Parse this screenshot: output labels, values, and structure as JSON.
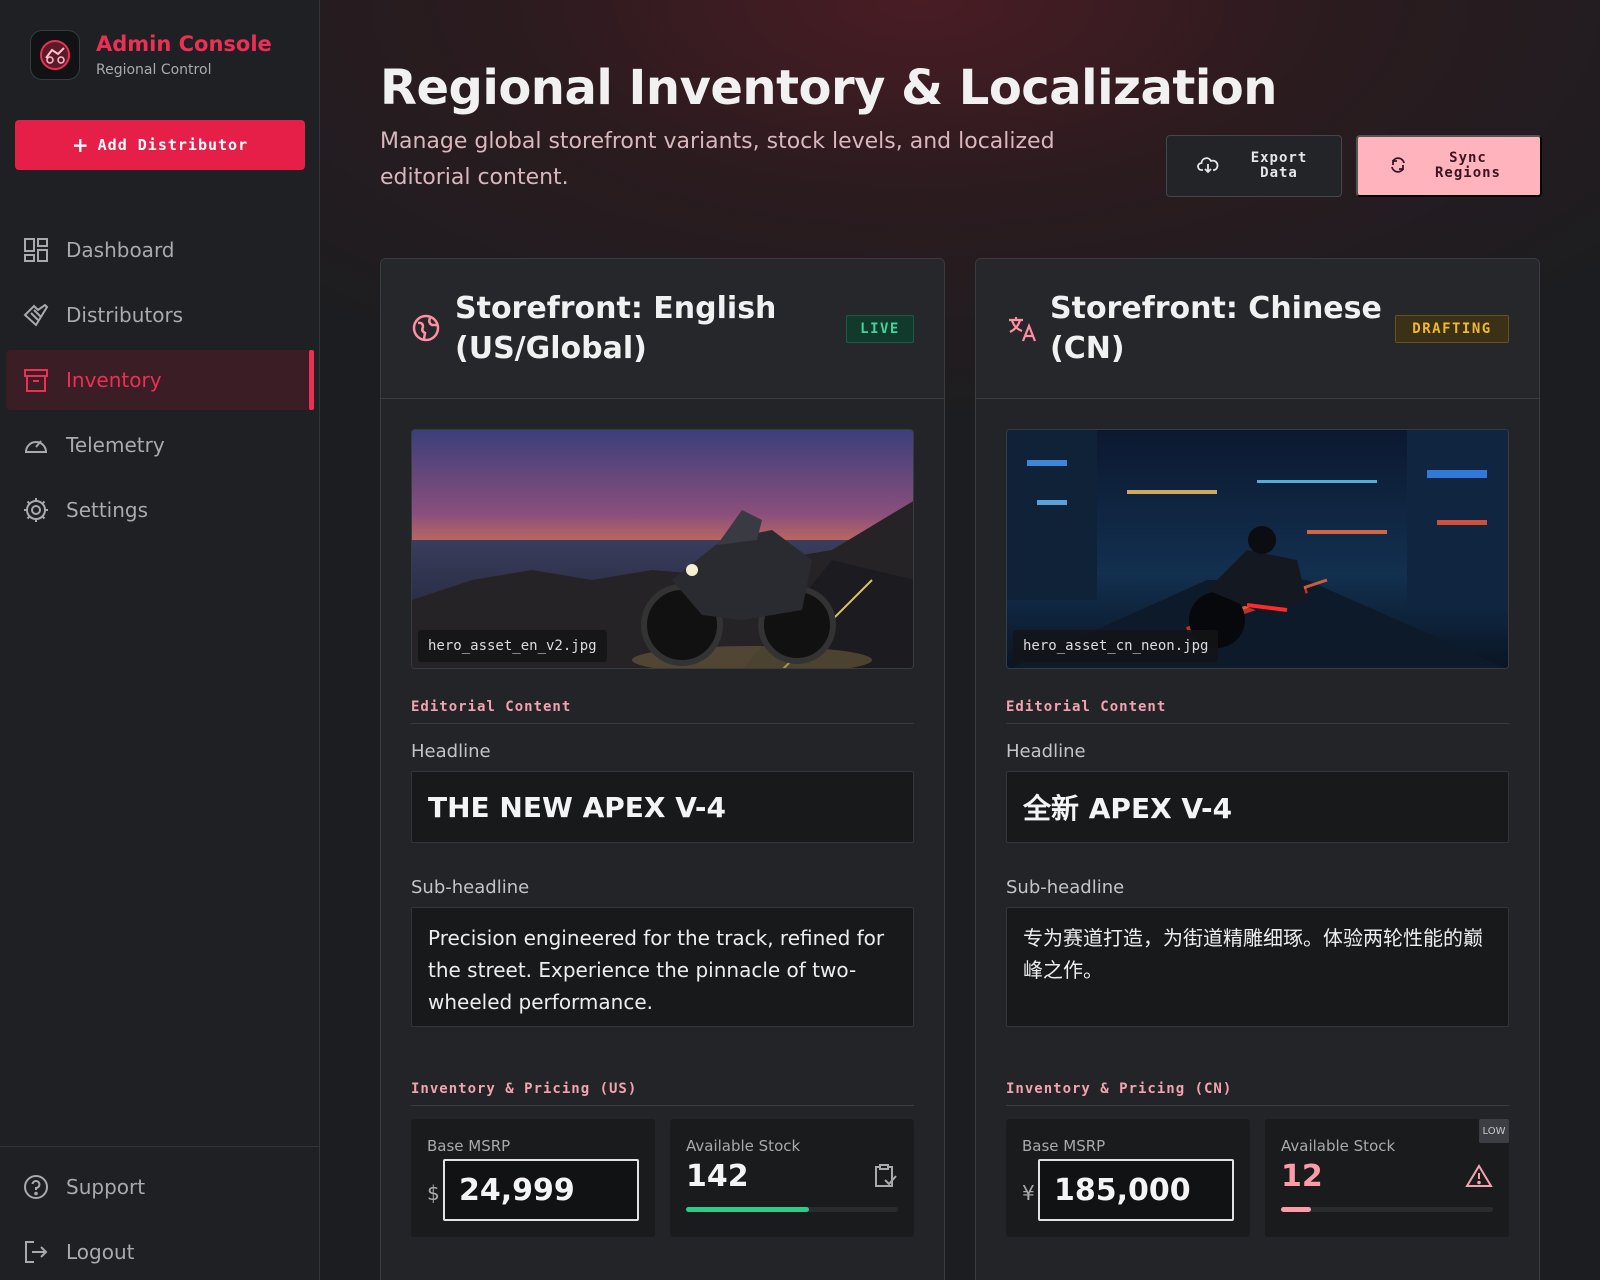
{
  "sidebar": {
    "brand_title": "Admin Console",
    "brand_subtitle": "Regional Control",
    "add_button": "Add Distributor",
    "nav": [
      {
        "label": "Dashboard",
        "icon": "dashboard-icon"
      },
      {
        "label": "Distributors",
        "icon": "handshake-icon"
      },
      {
        "label": "Inventory",
        "icon": "archive-icon",
        "active": true
      },
      {
        "label": "Telemetry",
        "icon": "speedometer-icon"
      },
      {
        "label": "Settings",
        "icon": "gear-icon"
      }
    ],
    "bottom": [
      {
        "label": "Support",
        "icon": "help-icon"
      },
      {
        "label": "Logout",
        "icon": "logout-icon"
      }
    ]
  },
  "header": {
    "title": "Regional Inventory & Localization",
    "subtitle": "Manage global storefront variants, stock levels, and localized editorial content.",
    "export_label": "Export Data",
    "sync_label": "Sync Regions"
  },
  "cards": [
    {
      "title": "Storefront: English (US/Global)",
      "icon": "globe-icon",
      "badge": "LIVE",
      "hero_file": "hero_asset_en_v2.jpg",
      "editorial_label": "Editorial Content",
      "headline_label": "Headline",
      "headline": "THE NEW APEX V-4",
      "subheadline_label": "Sub-headline",
      "subheadline": "Precision engineered for the track, refined for the street. Experience the pinnacle of two-wheeled performance.",
      "inventory_label": "Inventory & Pricing (US)",
      "msrp_label": "Base MSRP",
      "currency": "$",
      "msrp": "24,999",
      "stock_label": "Available Stock",
      "stock": "142",
      "stock_level": 0.58,
      "stock_color": "#2ecc8a"
    },
    {
      "title": "Storefront: Chinese (CN)",
      "icon": "translate-icon",
      "badge": "DRAFTING",
      "hero_file": "hero_asset_cn_neon.jpg",
      "editorial_label": "Editorial Content",
      "headline_label": "Headline",
      "headline": "全新 APEX V-4",
      "subheadline_label": "Sub-headline",
      "subheadline": "专为赛道打造，为街道精雕细琢。体验两轮性能的巅峰之作。",
      "inventory_label": "Inventory & Pricing (CN)",
      "msrp_label": "Base MSRP",
      "currency": "¥",
      "msrp": "185,000",
      "stock_label": "Available Stock",
      "stock": "12",
      "stock_level": 0.14,
      "stock_color": "#ff9aa9",
      "low_tag": "LOW"
    }
  ],
  "colors": {
    "accent": "#e61f48",
    "live": "#3fd49a",
    "drafting": "#f0b72f"
  }
}
